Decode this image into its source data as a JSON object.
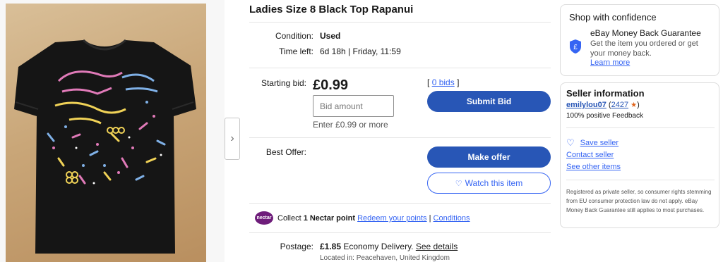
{
  "item": {
    "title": "Ladies Size 8 Black Top Rapanui",
    "condition_label": "Condition:",
    "condition_value": "Used",
    "time_left_label": "Time left:",
    "time_left_value": "6d 18h | Friday, 11:59"
  },
  "bidding": {
    "starting_bid_label": "Starting bid:",
    "price": "£0.99",
    "bid_placeholder": "Bid amount",
    "enter_hint": "Enter £0.99 or more",
    "bids_open": "[",
    "bids_link": "0 bids",
    "bids_close": "]",
    "submit_label": "Submit Bid"
  },
  "offer": {
    "best_offer_label": "Best Offer:",
    "make_offer_label": "Make offer",
    "watch_label": "Watch this item",
    "watch_icon": "heart-outline"
  },
  "nectar": {
    "badge": "nectar",
    "text_prefix": "Collect ",
    "points": "1 Nectar point",
    "redeem_link": "Redeem your points",
    "separator": " | ",
    "conditions_link": "Conditions"
  },
  "postage": {
    "label": "Postage:",
    "cost": "£1.85",
    "service": " Economy Delivery. ",
    "details_link": "See details",
    "located": "Located in: Peacehaven, United Kingdom"
  },
  "confidence": {
    "title": "Shop with confidence",
    "guarantee_title": "eBay Money Back Guarantee",
    "guarantee_text": "Get the item you ordered or get your money back.",
    "learn_more": "Learn more",
    "icon": "shield-pound-icon"
  },
  "seller": {
    "title": "Seller information",
    "username": "emilylou07",
    "feedback_open": " (",
    "feedback_count": "2427",
    "feedback_close": ")",
    "positive": "100% positive Feedback",
    "save_seller": "Save seller",
    "contact_seller": "Contact seller",
    "other_items": "See other items",
    "legal": "Registered as private seller, so consumer rights stemming from EU consumer protection law do not apply. eBay Money Back Guarantee still applies to most purchases."
  },
  "colors": {
    "accent_blue": "#3665f3",
    "button_blue": "#2856b6",
    "nectar_purple": "#6e1d7a",
    "star_orange": "#e0641a"
  }
}
